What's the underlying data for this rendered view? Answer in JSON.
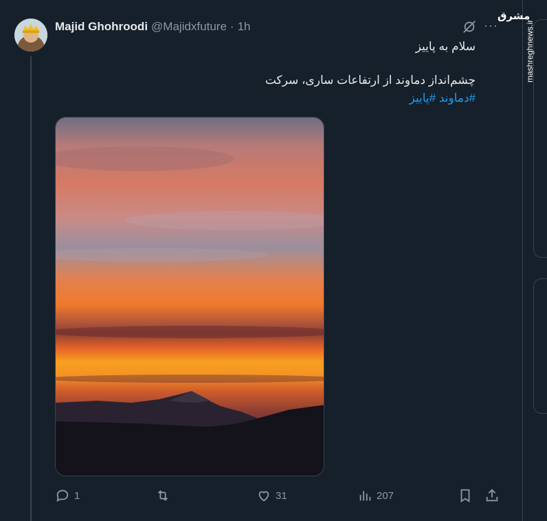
{
  "tweet": {
    "author_name": "Majid Ghohroodi",
    "handle": "@Majidxfuture",
    "separator": "·",
    "time": "1h",
    "line1": "سلام به پاییز",
    "line2": "چشم‌انداز دماوند از ارتفاعات ساری، سرکت",
    "hashtags": "#دماوند #پاییز",
    "more_label": "···"
  },
  "actions": {
    "replies": "1",
    "reposts": "",
    "likes": "31",
    "views": "207"
  },
  "watermark": {
    "logo": "مشرق",
    "site": "mashreghnews.ir"
  },
  "colors": {
    "background": "#15202b",
    "text": "#e7e9ea",
    "muted": "#8b98a5",
    "link": "#1d9bf0",
    "border": "#38444d"
  }
}
